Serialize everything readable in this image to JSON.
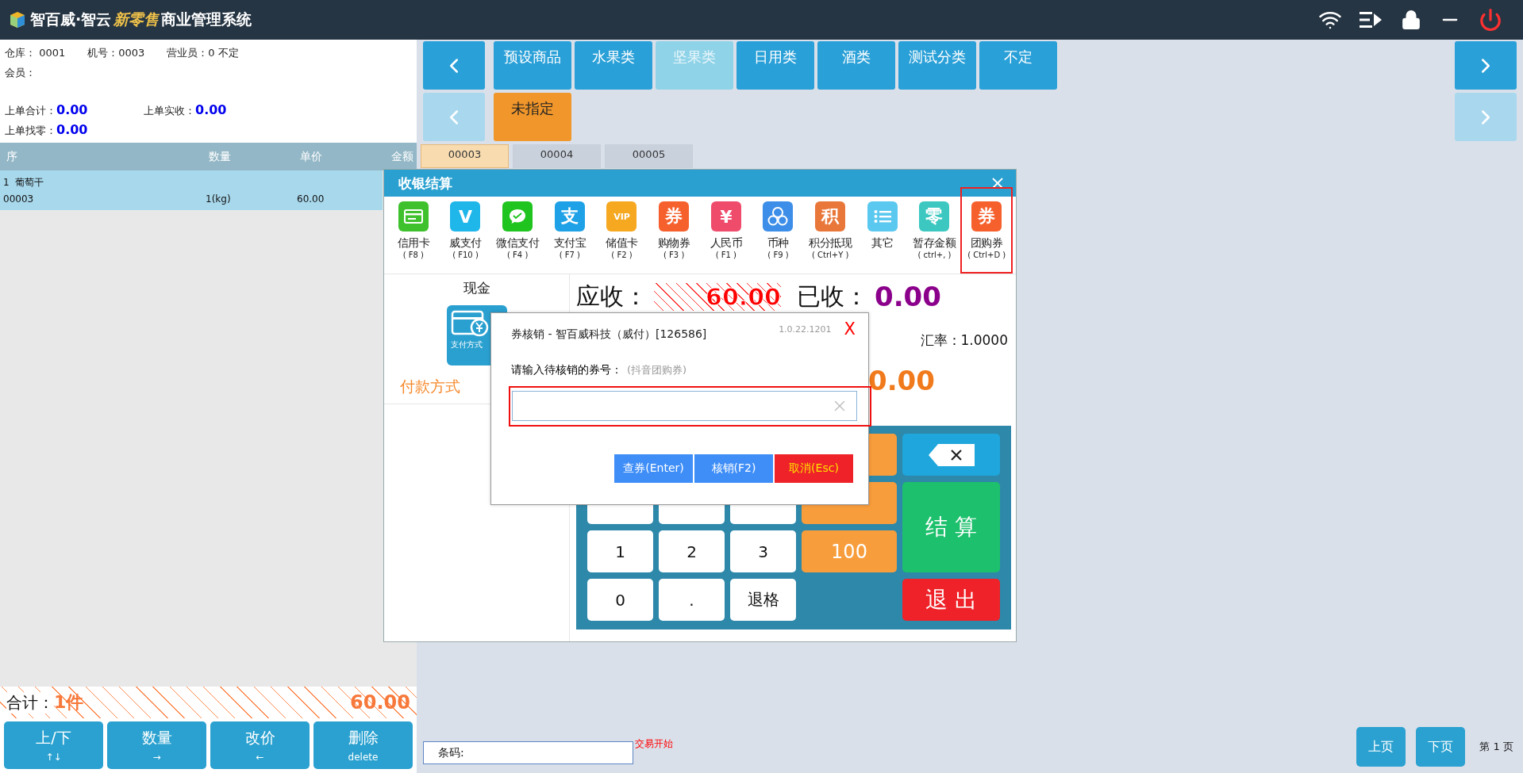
{
  "window": {
    "title": "智百威·智云",
    "title_accent": "新零售",
    "title_rest": "商业管理系统"
  },
  "info": {
    "warehouse": "仓库： 0001",
    "machine": "机号：0003",
    "clerk": "营业员：0 不定",
    "member": "会员：",
    "last_total_label": "上单合计：",
    "last_total": "0.00",
    "last_paid_label": "上单实收：",
    "last_paid": "0.00",
    "last_change_label": "上单找零：",
    "last_change": "0.00"
  },
  "table": {
    "columns": [
      "序",
      "数量",
      "单价",
      "金额"
    ],
    "rows": [
      {
        "index": "1",
        "name": "葡萄干",
        "code": "00003",
        "qty": "1(kg)",
        "price": "60.00",
        "selected": true
      }
    ]
  },
  "totals": {
    "label": "合计：",
    "count": "1件",
    "amount": "60.00"
  },
  "actions": [
    {
      "label": "上/下",
      "hint": "↑↓"
    },
    {
      "label": "数量",
      "hint": "→"
    },
    {
      "label": "改价",
      "hint": "←"
    },
    {
      "label": "删除",
      "hint": "delete"
    }
  ],
  "categories": {
    "rows": [
      {
        "prev_disabled": false,
        "next_disabled": false,
        "items": [
          {
            "label": "预设商品",
            "selected": false,
            "kind": "normal"
          },
          {
            "label": "水果类",
            "selected": false,
            "kind": "normal"
          },
          {
            "label": "坚果类",
            "selected": true,
            "kind": "normal"
          },
          {
            "label": "日用类",
            "selected": false,
            "kind": "normal"
          },
          {
            "label": "酒类",
            "selected": false,
            "kind": "normal"
          },
          {
            "label": "测试分类",
            "selected": false,
            "kind": "normal"
          },
          {
            "label": "不定",
            "selected": false,
            "kind": "normal"
          }
        ]
      },
      {
        "prev_disabled": true,
        "next_disabled": true,
        "items": [
          {
            "label": "未指定",
            "selected": false,
            "kind": "special"
          }
        ]
      }
    ]
  },
  "orders": [
    {
      "label": "00003",
      "selected": true
    },
    {
      "label": "00004",
      "selected": false
    },
    {
      "label": "00005",
      "selected": false
    }
  ],
  "payment": {
    "title": "收银结算",
    "methods": [
      {
        "label": "信用卡",
        "key": "( F8 )",
        "kind": "card",
        "color": "#3ec12c",
        "selected": false
      },
      {
        "label": "威支付",
        "key": "( F10 )",
        "kind": "glyph",
        "glyph": "V",
        "color": "#1fb6ea",
        "selected": false
      },
      {
        "label": "微信支付",
        "key": "( F4 )",
        "kind": "chat",
        "color": "#1fc41f",
        "selected": false
      },
      {
        "label": "支付宝",
        "key": "( F7 )",
        "kind": "glyph",
        "glyph": "支",
        "color": "#1ea1e6",
        "selected": false
      },
      {
        "label": "储值卡",
        "key": "( F2 )",
        "kind": "glyph",
        "glyph": "VIP",
        "color": "#f6a821",
        "selected": false
      },
      {
        "label": "购物券",
        "key": "( F3 )",
        "kind": "glyph",
        "glyph": "券",
        "color": "#f6602d",
        "selected": false
      },
      {
        "label": "人民币",
        "key": "( F1 )",
        "kind": "glyph",
        "glyph": "¥",
        "color": "#ef4b6b",
        "selected": false
      },
      {
        "label": "币种",
        "key": "( F9 )",
        "kind": "coins",
        "color": "#3d8ee8",
        "selected": false
      },
      {
        "label": "积分抵现",
        "key": "( Ctrl+Y )",
        "kind": "glyph",
        "glyph": "积",
        "color": "#e9773a",
        "selected": false
      },
      {
        "label": "其它",
        "kind": "list",
        "color": "#5bc8f0",
        "selected": false
      },
      {
        "label": "暂存金额",
        "key": "( ctrl+, )",
        "kind": "glyph",
        "glyph": "零",
        "color": "#3cc8c0",
        "selected": false
      },
      {
        "label": "团购券",
        "key": "( Ctrl+D )",
        "kind": "glyph",
        "glyph": "券",
        "color": "#f6602d",
        "selected": true
      }
    ],
    "cash_title": "现金",
    "method_list_label": "支付方式",
    "section_label": "付款方式",
    "due_label": "应收：",
    "due": "60.00",
    "received_label": "已收：",
    "received": "0.00",
    "rate": "汇率：1.0000",
    "change": "0.00",
    "keys": [
      {
        "kind": "digit"
      },
      {
        "kind": "digit"
      },
      {
        "kind": "digit"
      },
      {
        "kind": "quick"
      },
      {
        "kind": "backspace"
      },
      {
        "kind": "digit"
      },
      {
        "kind": "digit"
      },
      {
        "kind": "digit"
      },
      {
        "kind": "quick"
      },
      {
        "kind": "settle",
        "label": "结 算"
      },
      {
        "kind": "digit",
        "label": "1"
      },
      {
        "kind": "digit",
        "label": "2"
      },
      {
        "kind": "digit",
        "label": "3"
      },
      {
        "kind": "quick",
        "label": "100"
      },
      {
        "kind": "digit",
        "label": "0"
      },
      {
        "kind": "digit",
        "label": "."
      },
      {
        "kind": "digit",
        "label": "退格"
      },
      {
        "kind": "blank"
      },
      {
        "kind": "exit",
        "label": "退 出"
      }
    ]
  },
  "coupon": {
    "title": "券核销 - 智百威科技（威付）[126586]",
    "version": "1.0.22.1201",
    "close": "X",
    "prompt": "请输入待核销的券号：",
    "hint": "(抖音团购券)",
    "input_highlighted": true,
    "buttons": [
      {
        "label": "查券(Enter)",
        "kind": "primary"
      },
      {
        "label": "核销(F2)",
        "kind": "primary"
      },
      {
        "label": "取消(Esc)",
        "kind": "danger"
      }
    ]
  },
  "bottom": {
    "barcode_label": "条码:",
    "status": "交易开始",
    "prev": "上页",
    "next": "下页",
    "page": "第 1 页"
  }
}
